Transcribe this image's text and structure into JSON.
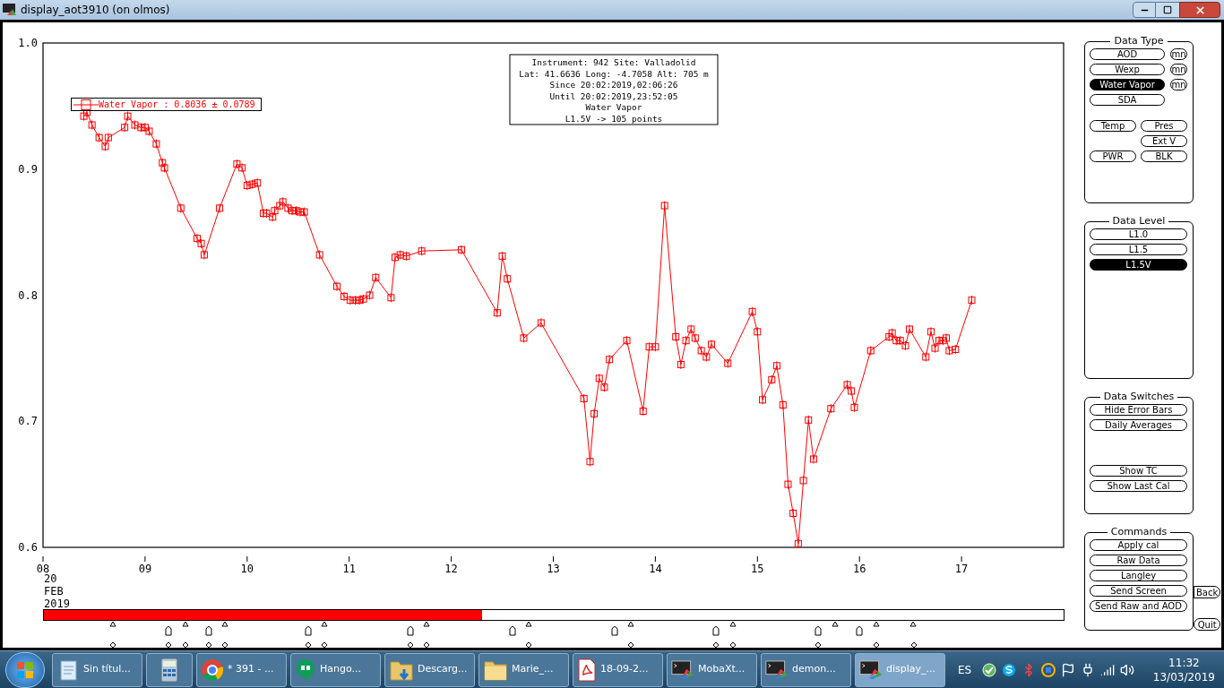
{
  "window": {
    "title": "display_aot3910 (on olmos)"
  },
  "chart": {
    "info_lines": [
      "Instrument: 942 Site: Valladolid",
      "Lat: 41.6636 Long: -4.7058 Alt: 705 m",
      "Since 20:02:2019,02:06:26",
      "Until 20:02:2019,23:52:05",
      "Water Vapor",
      "L1.5V -> 105 points"
    ],
    "legend_value": ": 0.8036 ± 0.0789",
    "date_lines": [
      "20",
      "FEB",
      "2019"
    ],
    "chart_data": {
      "type": "line",
      "xlim": [
        8,
        18
      ],
      "ylim": [
        0.6,
        1.0
      ],
      "xticks": [
        {
          "value": 8,
          "label": "08"
        },
        {
          "value": 9,
          "label": "09"
        },
        {
          "value": 10,
          "label": "10"
        },
        {
          "value": 11,
          "label": "11"
        },
        {
          "value": 12,
          "label": "12"
        },
        {
          "value": 13,
          "label": "13"
        },
        {
          "value": 14,
          "label": "14"
        },
        {
          "value": 15,
          "label": "15"
        },
        {
          "value": 16,
          "label": "16"
        },
        {
          "value": 17,
          "label": "17"
        }
      ],
      "yticks": [
        {
          "value": 0.6,
          "label": "0.6"
        },
        {
          "value": 0.7,
          "label": "0.7"
        },
        {
          "value": 0.8,
          "label": "0.8"
        },
        {
          "value": 0.9,
          "label": "0.9"
        },
        {
          "value": 1.0,
          "label": "1.0"
        }
      ],
      "x": [
        8.4,
        8.43,
        8.48,
        8.55,
        8.61,
        8.64,
        8.8,
        8.83,
        8.9,
        8.96,
        9.0,
        9.04,
        9.11,
        9.17,
        9.19,
        9.35,
        9.51,
        9.55,
        9.58,
        9.73,
        9.9,
        9.95,
        10.0,
        10.05,
        10.1,
        10.16,
        10.19,
        10.25,
        10.27,
        10.32,
        10.35,
        10.4,
        10.44,
        10.48,
        10.52,
        10.56,
        10.71,
        10.88,
        10.95,
        11.01,
        11.06,
        11.1,
        11.14,
        11.2,
        11.26,
        11.41,
        11.45,
        11.5,
        11.56,
        11.71,
        12.1,
        12.45,
        12.5,
        12.55,
        12.71,
        12.88,
        13.3,
        13.36,
        13.4,
        13.45,
        13.5,
        13.55,
        13.72,
        13.88,
        13.94,
        14.0,
        14.09,
        14.2,
        14.25,
        14.3,
        14.35,
        14.39,
        14.45,
        14.5,
        14.55,
        14.71,
        14.95,
        15.0,
        15.05,
        15.14,
        15.19,
        15.25,
        15.3,
        15.35,
        15.4,
        15.45,
        15.5,
        15.55,
        15.72,
        15.88,
        15.92,
        15.95,
        16.11,
        16.29,
        16.32,
        16.36,
        16.4,
        16.45,
        16.49,
        16.65,
        16.7,
        16.74,
        16.78,
        16.82,
        16.85,
        16.88,
        16.94,
        17.1
      ],
      "series": [
        {
          "name": "Water Vapor",
          "color": "#ff0000",
          "marker": "square",
          "values": [
            0.942,
            0.945,
            0.935,
            0.925,
            0.918,
            0.925,
            0.933,
            0.942,
            0.935,
            0.933,
            0.933,
            0.93,
            0.92,
            0.905,
            0.901,
            0.869,
            0.845,
            0.841,
            0.832,
            0.869,
            0.904,
            0.901,
            0.887,
            0.888,
            0.889,
            0.865,
            0.865,
            0.862,
            0.867,
            0.871,
            0.874,
            0.869,
            0.867,
            0.867,
            0.866,
            0.866,
            0.832,
            0.807,
            0.799,
            0.796,
            0.796,
            0.796,
            0.797,
            0.8,
            0.814,
            0.798,
            0.83,
            0.832,
            0.831,
            0.835,
            0.836,
            0.786,
            0.831,
            0.813,
            0.766,
            0.778,
            0.718,
            0.668,
            0.706,
            0.734,
            0.727,
            0.749,
            0.764,
            0.708,
            0.759,
            0.759,
            0.871,
            0.767,
            0.745,
            0.764,
            0.773,
            0.766,
            0.756,
            0.751,
            0.761,
            0.746,
            0.787,
            0.771,
            0.717,
            0.733,
            0.744,
            0.713,
            0.65,
            0.627,
            0.603,
            0.653,
            0.701,
            0.67,
            0.71,
            0.729,
            0.724,
            0.711,
            0.756,
            0.767,
            0.77,
            0.764,
            0.764,
            0.76,
            0.773,
            0.751,
            0.771,
            0.758,
            0.764,
            0.764,
            0.766,
            0.756,
            0.757,
            0.796
          ]
        }
      ]
    }
  },
  "progress": {
    "level": 0.43
  },
  "panels": {
    "data_type": {
      "title": "Data Type",
      "buttons": [
        {
          "label": "AOD",
          "selected": false,
          "mn": "mn"
        },
        {
          "label": "Wexp",
          "selected": false,
          "mn": "mn"
        },
        {
          "label": "Water Vapor",
          "selected": true,
          "mn": "mn"
        },
        {
          "label": "SDA",
          "selected": false
        }
      ],
      "rows": [
        {
          "left": "Temp",
          "right": "Pres"
        },
        {
          "right": "Ext V"
        },
        {
          "left": "PWR",
          "right": "BLK"
        }
      ]
    },
    "data_level": {
      "title": "Data Level",
      "buttons": [
        {
          "label": "L1.0",
          "selected": false
        },
        {
          "label": "L1.5",
          "selected": false
        },
        {
          "label": "L1.5V",
          "selected": true
        }
      ]
    },
    "data_switches": {
      "title": "Data Switches",
      "groups": [
        [
          "Hide Error Bars",
          "Daily Averages"
        ],
        [
          "Show TC",
          "Show Last Cal"
        ]
      ]
    },
    "commands": {
      "title": "Commands",
      "buttons": [
        "Apply cal",
        "Raw Data",
        "Langley",
        "Send Screen",
        "Send Raw and AOD"
      ]
    },
    "back": "Back",
    "quit": "Quit"
  },
  "taskbar": {
    "items": [
      {
        "kind": "notepad",
        "label": "Sin títul...",
        "selected": false
      },
      {
        "kind": "calculator",
        "selected": false
      },
      {
        "kind": "browser",
        "label": "* 391 - ...",
        "selected": false
      },
      {
        "kind": "chat",
        "label": "Hango...",
        "selected": false
      },
      {
        "kind": "downloads",
        "label": "Descarg...",
        "selected": false
      },
      {
        "kind": "folder",
        "label": "Marie_...",
        "selected": false
      },
      {
        "kind": "pdf",
        "label": "18-09-2...",
        "selected": false
      },
      {
        "kind": "terminal",
        "label": "MobaXt...",
        "selected": false
      },
      {
        "kind": "terminal",
        "label": "demon...",
        "selected": false
      },
      {
        "kind": "terminal",
        "label": "display_...",
        "selected": true
      }
    ],
    "language": "ES",
    "time": "11:32",
    "date": "13/03/2019"
  }
}
